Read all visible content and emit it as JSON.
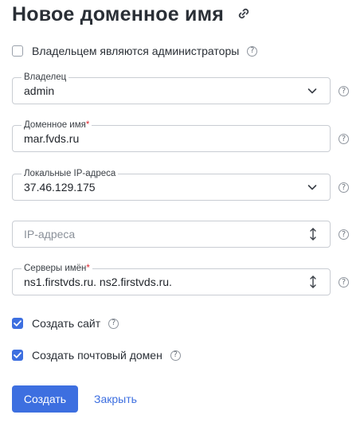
{
  "title": "Новое доменное имя",
  "owner_is_admins": {
    "label": "Владельцем являются администраторы",
    "checked": false
  },
  "owner": {
    "label": "Владелец",
    "value": "admin"
  },
  "domain_name": {
    "label": "Доменное имя",
    "required_mark": "*",
    "value": "mar.fvds.ru"
  },
  "local_ips": {
    "label": "Локальные IP-адреса",
    "value": "37.46.129.175"
  },
  "ip_addresses": {
    "placeholder": "IP-адреса",
    "value": ""
  },
  "name_servers": {
    "label": "Серверы имён",
    "required_mark": "*",
    "value": "ns1.firstvds.ru. ns2.firstvds.ru."
  },
  "create_site": {
    "label": "Создать сайт",
    "checked": true
  },
  "create_mail_domain": {
    "label": "Создать почтовый домен",
    "checked": true
  },
  "buttons": {
    "create": "Создать",
    "close": "Закрыть"
  },
  "help_glyph": "?",
  "colors": {
    "accent": "#3d6fe0",
    "required": "#e0262f",
    "border": "#c9cdd3"
  },
  "icons": [
    "link-icon",
    "help-icon",
    "chevron-down-icon",
    "up-down-arrows-icon",
    "checkmark-icon"
  ]
}
